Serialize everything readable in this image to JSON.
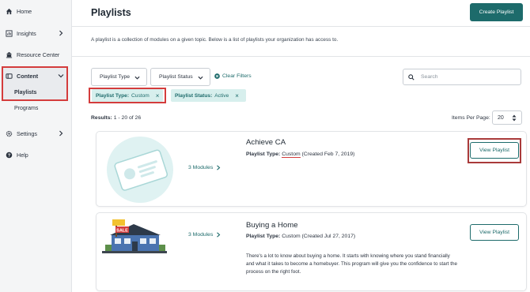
{
  "sidebar": {
    "items": [
      {
        "label": "Home",
        "icon": "home-icon"
      },
      {
        "label": "Insights",
        "icon": "chart-icon"
      },
      {
        "label": "Resource Center",
        "icon": "building-icon"
      },
      {
        "label": "Content",
        "icon": "content-icon"
      },
      {
        "label": "Settings",
        "icon": "gear-icon"
      },
      {
        "label": "Help",
        "icon": "help-icon"
      }
    ],
    "sub_items": [
      {
        "label": "Playlists"
      },
      {
        "label": "Programs"
      }
    ]
  },
  "header": {
    "title": "Playlists",
    "create_label": "Create Playlist"
  },
  "description": "A playlist is a collection of modules on a given topic. Below is a list of playlists your organization has access to.",
  "filters": {
    "type_label": "Playlist Type",
    "status_label": "Playlist Status",
    "clear_label": "Clear Filters",
    "search_placeholder": "Search",
    "chips": [
      {
        "key": "Playlist Type:",
        "value": "Custom",
        "remove": "×"
      },
      {
        "key": "Playlist Status:",
        "value": "Active",
        "remove": "×"
      }
    ]
  },
  "results": {
    "label": "Results:",
    "range": "1 - 20 of 26",
    "per_page_label": "Items Per Page:",
    "per_page_value": "20"
  },
  "playlists": [
    {
      "title": "Achieve CA",
      "type_key": "Playlist Type:",
      "type_value": "Custom",
      "created": "(Created Feb 7, 2019)",
      "modules": "3 Modules",
      "button": "View Playlist"
    },
    {
      "title": "Buying a Home",
      "type_key": "Playlist Type:",
      "type_value": "Custom",
      "created": "(Created Jul 27, 2017)",
      "modules": "3 Modules",
      "button": "View Playlist",
      "description": "There's a lot to know about buying a home. It starts with knowing where you stand financially and what it takes to become a homebuyer. This program will give you the confidence to start the process on the right foot.",
      "sign_text": "SALE"
    }
  ],
  "colors": {
    "accent": "#1d6b6b",
    "highlight": "#d43c3c",
    "chip_bg": "#d7efed"
  }
}
